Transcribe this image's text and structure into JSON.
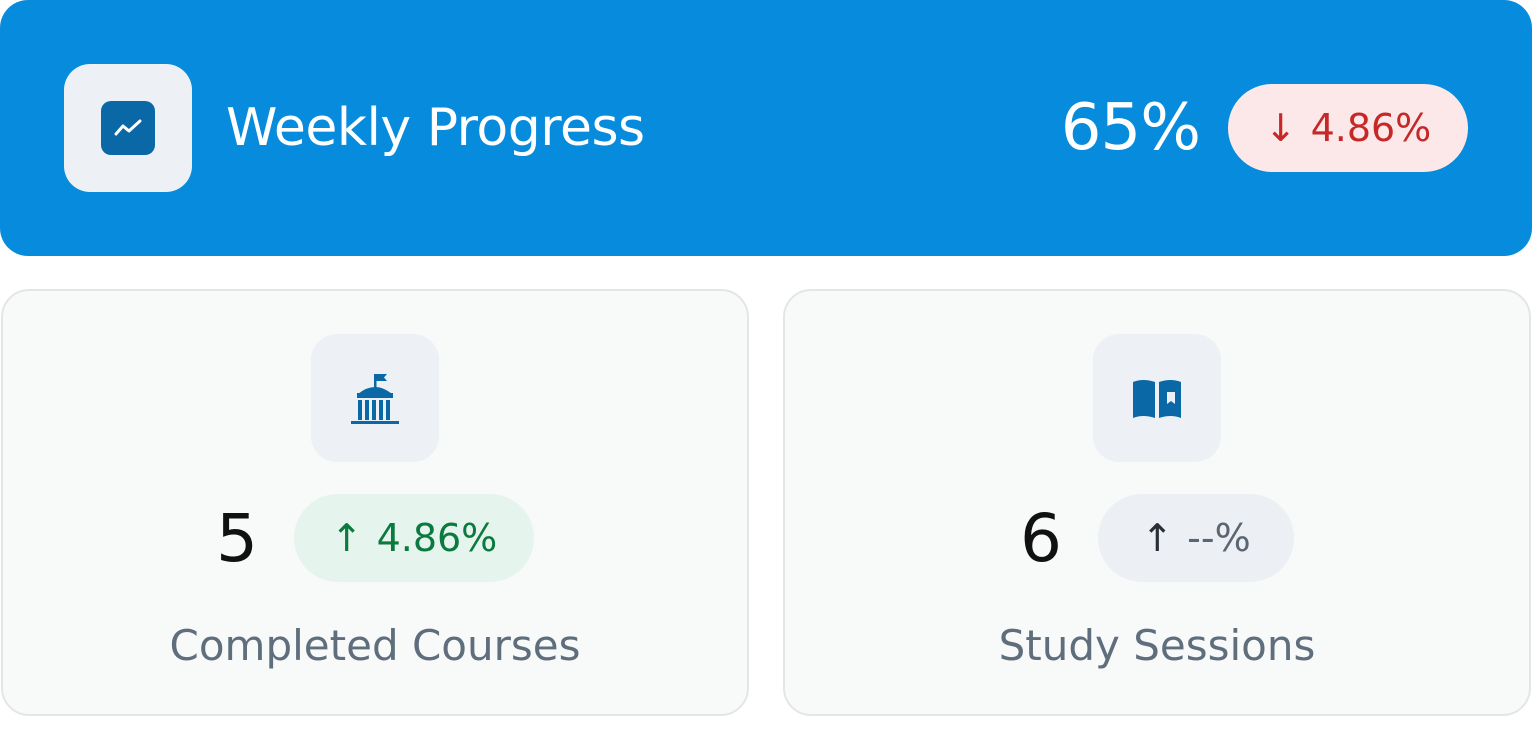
{
  "header": {
    "title": "Weekly Progress",
    "icon": "trend-line-icon",
    "value": "65%",
    "change": {
      "arrow": "↓",
      "text": "4.86%",
      "direction": "down",
      "color": "#c62828",
      "background": "#fce8e8"
    },
    "background": "#078bdc"
  },
  "cards": [
    {
      "icon": "school-building-icon",
      "value": "5",
      "change": {
        "arrow": "↑",
        "text": "4.86%",
        "direction": "up",
        "color": "#0a7a3e",
        "background": "#e6f4ee"
      },
      "label": "Completed Courses"
    },
    {
      "icon": "open-book-icon",
      "value": "6",
      "change": {
        "arrow": "↑",
        "text": "--%",
        "direction": "neutral",
        "color": "#5a6672",
        "background": "#eceff3"
      },
      "label": "Study Sessions"
    }
  ],
  "accent": "#0a68a6"
}
